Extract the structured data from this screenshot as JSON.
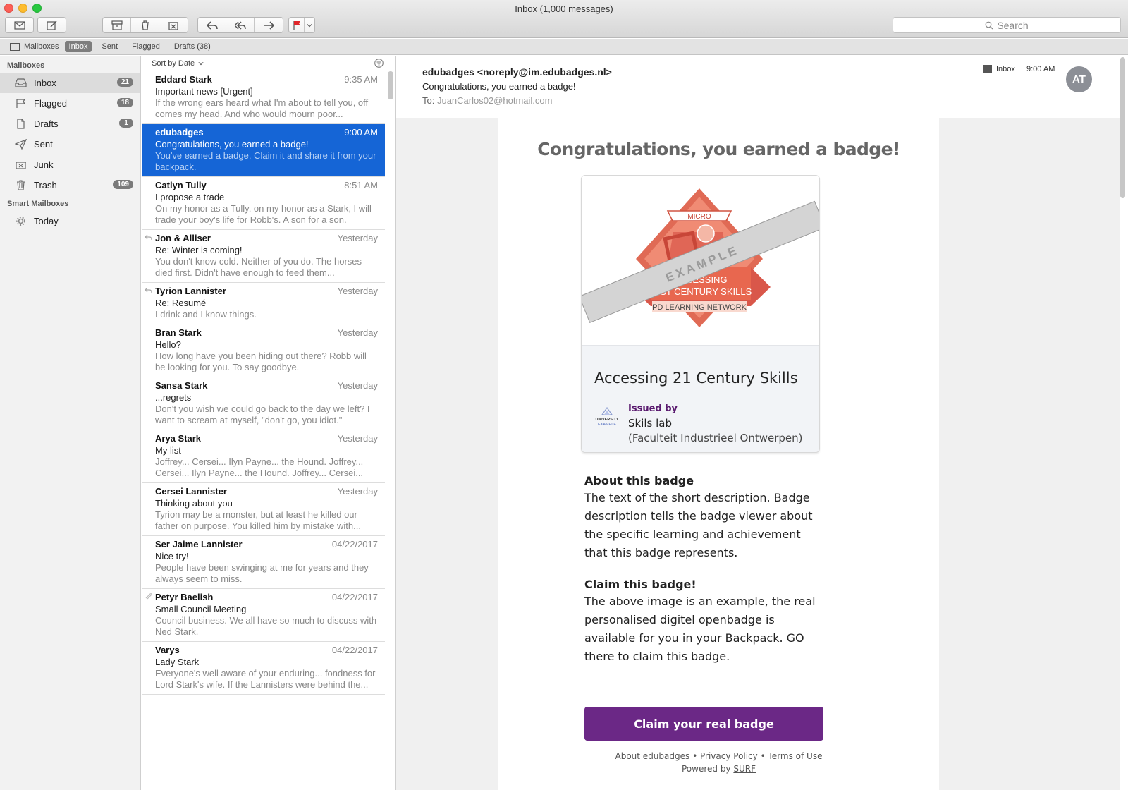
{
  "window": {
    "title": "Inbox (1,000 messages)"
  },
  "search": {
    "placeholder": "Search"
  },
  "favorites": {
    "mailboxes": "Mailboxes",
    "inbox": "Inbox",
    "sent": "Sent",
    "flagged": "Flagged",
    "drafts": "Drafts (38)"
  },
  "sidebar": {
    "header_mailboxes": "Mailboxes",
    "header_smart": "Smart Mailboxes",
    "items": [
      {
        "label": "Inbox",
        "badge": "21",
        "icon": "inbox-icon"
      },
      {
        "label": "Flagged",
        "badge": "18",
        "icon": "flag-icon"
      },
      {
        "label": "Drafts",
        "badge": "1",
        "icon": "document-icon"
      },
      {
        "label": "Sent",
        "badge": "",
        "icon": "paper-plane-icon"
      },
      {
        "label": "Junk",
        "badge": "",
        "icon": "junk-tray-icon"
      },
      {
        "label": "Trash",
        "badge": "109",
        "icon": "trash-icon"
      }
    ],
    "smart_items": [
      {
        "label": "Today",
        "icon": "gear-icon"
      }
    ]
  },
  "list": {
    "sort_label": "Sort by Date",
    "messages": [
      {
        "from": "Eddard Stark",
        "date": "9:35 AM",
        "subject": "Important news [Urgent]",
        "preview": "If the wrong ears heard what I'm about to tell you, off comes my head. And who would mourn poor..."
      },
      {
        "from": "edubadges",
        "date": "9:00 AM",
        "subject": "Congratulations, you earned a badge!",
        "preview": "You've earned a badge. Claim it and share it from your backpack."
      },
      {
        "from": "Catlyn Tully",
        "date": "8:51 AM",
        "subject": "I propose a trade",
        "preview": "On my honor as a Tully, on my honor as a Stark, I will trade your boy's life for Robb's. A son for a son."
      },
      {
        "from": "Jon & Alliser",
        "date": "Yesterday",
        "subject": "Re: Winter is coming!",
        "preview": "You don't know cold. Neither of you do. The horses died first. Didn't have enough to feed them..."
      },
      {
        "from": "Tyrion Lannister",
        "date": "Yesterday",
        "subject": "Re: Resumé",
        "preview": "I drink and I know things."
      },
      {
        "from": "Bran Stark",
        "date": "Yesterday",
        "subject": "Hello?",
        "preview": "How long have you been hiding out there? Robb will be looking for you. To say goodbye."
      },
      {
        "from": "Sansa Stark",
        "date": "Yesterday",
        "subject": "...regrets",
        "preview": "Don't you wish we could go back to the day we left? I want to scream at myself, \"don't go, you idiot.\""
      },
      {
        "from": "Arya Stark",
        "date": "Yesterday",
        "subject": "My list",
        "preview": "Joffrey... Cersei... Ilyn Payne... the Hound. Joffrey... Cersei... Ilyn Payne... the Hound. Joffrey... Cersei..."
      },
      {
        "from": "Cersei Lannister",
        "date": "Yesterday",
        "subject": "Thinking about you",
        "preview": "Tyrion may be a monster, but at least he killed our father on purpose. You killed him by mistake with..."
      },
      {
        "from": "Ser Jaime Lannister",
        "date": "04/22/2017",
        "subject": "Nice try!",
        "preview": "People have been swinging at me for years and they always seem to miss."
      },
      {
        "from": "Petyr Baelish",
        "date": "04/22/2017",
        "subject": "Small Council Meeting",
        "preview": "Council business. We all have so much to discuss with Ned Stark."
      },
      {
        "from": "Varys",
        "date": "04/22/2017",
        "subject": "Lady Stark",
        "preview": "Everyone's well aware of your enduring... fondness for Lord Stark's wife. If the Lannisters were behind the..."
      }
    ]
  },
  "reader": {
    "sender": "edubadges <noreply@im.edubadges.nl>",
    "subject": "Congratulations, you earned a badge!",
    "to_label": "To:",
    "to_address": "JuanCarlos02@hotmail.com",
    "mailbox_tag": "Inbox",
    "time": "9:00 AM",
    "avatar_initials": "AT"
  },
  "email": {
    "heading": "Congratulations, you earned a badge!",
    "badge_ribbon_top": "MICRO",
    "badge_line1": "ASSESSING",
    "badge_line2": "21ST CENTURY SKILLS",
    "badge_line3": "PD LEARNING NETWORK",
    "example_banner": "EXAMPLE",
    "badge_name": "Accessing 21 Century Skills",
    "logo_line1": "UNIVERSITY",
    "logo_line2": "EXAMPLE",
    "issued_by_label": "Issued by",
    "issuer": "Skils lab",
    "issuer_dept": "(Faculteit Industrieel Ontwerpen)",
    "about_title": "About this badge",
    "about_text": "The text of the short description. Badge description tells the badge viewer about the specific learning and achievement that this badge represents.",
    "claim_title": "Claim this badge!",
    "claim_text": "The above image is an example, the real personalised digitel openbadge is available for you in your Backpack. GO there to claim this badge.",
    "claim_button": "Claim your real badge",
    "footer_about": "About edubadges",
    "footer_privacy": "Privacy Policy",
    "footer_terms": "Terms of Use",
    "footer_powered": "Powered by",
    "footer_surf": "SURF"
  }
}
